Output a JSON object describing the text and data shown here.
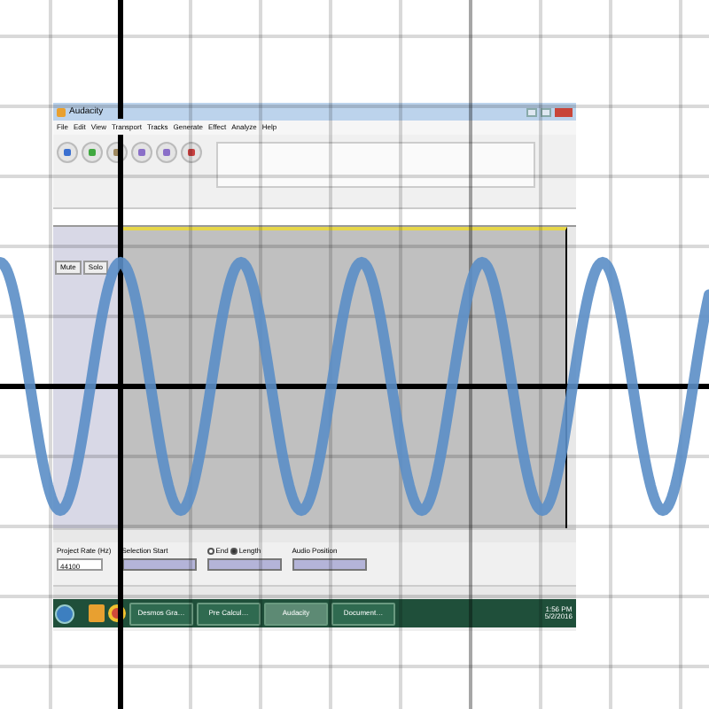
{
  "image": {
    "title": "Audacity",
    "menu": [
      "File",
      "Edit",
      "View",
      "Transport",
      "Tracks",
      "Generate",
      "Effect",
      "Analyze",
      "Help"
    ],
    "track": {
      "buttons": [
        "Mute",
        "Solo"
      ]
    },
    "selection_bar": {
      "project_rate_label": "Project Rate (Hz)",
      "project_rate": "44100",
      "selection_start_label": "Selection Start",
      "end_label": "End",
      "length_label": "Length",
      "length_selected": true,
      "audio_position_label": "Audio Position"
    },
    "taskbar": {
      "items": [
        {
          "label": "Desmos Gra…",
          "selected": false
        },
        {
          "label": "Pre Calcul…",
          "selected": false
        },
        {
          "label": "Audacity",
          "selected": true
        },
        {
          "label": "Document…",
          "selected": false
        }
      ],
      "clock_time": "1:56 PM",
      "clock_date": "5/2/2016"
    }
  },
  "graph": {
    "curves": [
      {
        "kind": "sine",
        "color": "#5b8ec7"
      }
    ]
  }
}
